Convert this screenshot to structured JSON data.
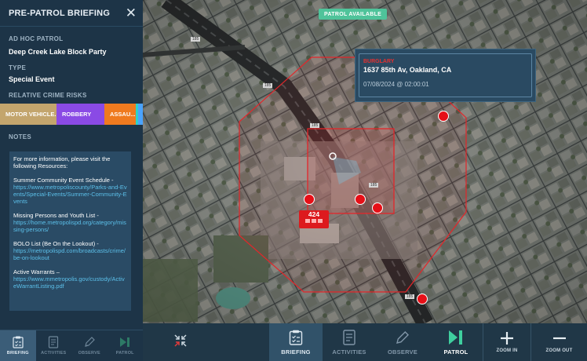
{
  "sidebar": {
    "title": "PRE-PATROL BRIEFING",
    "adhoc_label": "AD HOC PATROL",
    "adhoc_value": "Deep Creek Lake Block Party",
    "type_label": "TYPE",
    "type_value": "Special Event",
    "risks_label": "RELATIVE CRIME RISKS",
    "risks": [
      {
        "label": "MOTOR VEHICLE...",
        "color": "#c3a56d"
      },
      {
        "label": "ROBBERY",
        "color": "#8a4ae5"
      },
      {
        "label": "ASSAU...",
        "color": "#ef7a1f"
      }
    ],
    "notes_label": "NOTES",
    "notes": {
      "intro": "For more information, please visit the following Resources:",
      "items": [
        {
          "title": "Summer Community Event Schedule -",
          "link": "https://www.metropoliscounty/Parks-and-Events/Special-Events/Summer-Community-Events"
        },
        {
          "title": "Missing Persons and Youth List -",
          "link": "https://home.metropolispd.org/category/missing-persons/"
        },
        {
          "title": "BOLO List (Be On the Lookout) -",
          "link": "https://metropolispd.com/broadcasts/crime/be-on-lookout"
        },
        {
          "title": "Active Warrants –",
          "link": "https://www.mmetropolis.gov/custody/ActiveWarrantListing.pdf"
        }
      ]
    },
    "tabs": [
      {
        "label": "BRIEFING",
        "icon": "clipboard-check-icon"
      },
      {
        "label": "ACTIVITIES",
        "icon": "activity-list-icon"
      },
      {
        "label": "OBSERVE",
        "icon": "pencil-icon"
      },
      {
        "label": "PATROL",
        "icon": "play-pause-icon"
      }
    ]
  },
  "map": {
    "badge": "PATROL AVAILABLE",
    "road_labels": [
      "185",
      "185",
      "185",
      "185",
      "185"
    ],
    "callout": {
      "incident_type": "BURGLARY",
      "address": "1637 85th Av, Oakland, CA",
      "datetime": "07/08/2024 @ 02:00:01"
    },
    "unit": {
      "number": "424"
    }
  },
  "toolbar": {
    "briefing": "BRIEFING",
    "activities": "ACTIVITIES",
    "observe": "OBSERVE",
    "patrol": "PATROL",
    "zoom_in": "ZOOM IN",
    "zoom_out": "ZOOM OUT"
  },
  "colors": {
    "accent_green": "#4fc39a",
    "incident_red": "#e60f17",
    "panel_blue": "#1d3447"
  }
}
